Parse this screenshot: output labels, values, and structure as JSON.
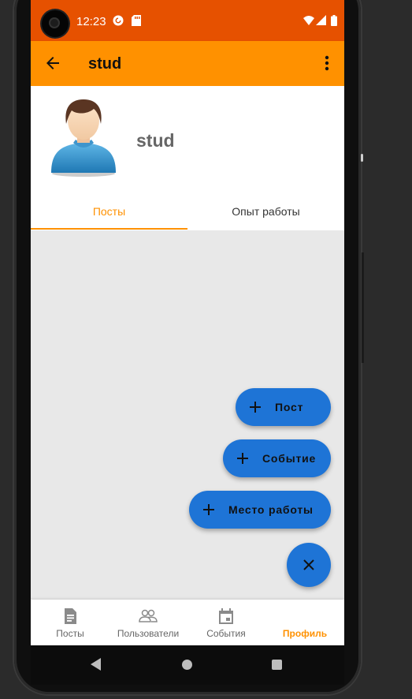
{
  "status_bar": {
    "time": "12:23",
    "left_icons": [
      "pocket-casts-icon",
      "sd-card-icon"
    ],
    "right_icons": [
      "wifi-icon",
      "signal-icon",
      "battery-icon"
    ]
  },
  "app_bar": {
    "title": "stud",
    "back_icon": "arrow-left-icon",
    "menu_icon": "more-vert-icon",
    "background": "#ff9100"
  },
  "profile": {
    "name": "stud",
    "avatar_icon": "user-avatar-icon"
  },
  "tabs": [
    {
      "label": "Посты",
      "selected": true
    },
    {
      "label": "Опыт работы",
      "selected": false
    }
  ],
  "fab_menu": {
    "items": [
      {
        "label": "Пост",
        "icon": "plus-icon"
      },
      {
        "label": "Событие",
        "icon": "plus-icon"
      },
      {
        "label": "Место работы",
        "icon": "plus-icon"
      }
    ],
    "close_icon": "close-icon",
    "color": "#1e74d6"
  },
  "bottom_nav": [
    {
      "label": "Посты",
      "icon": "document-icon",
      "active": false
    },
    {
      "label": "Пользователи",
      "icon": "people-icon",
      "active": false
    },
    {
      "label": "События",
      "icon": "calendar-icon",
      "active": false
    },
    {
      "label": "Профиль",
      "icon": "",
      "active": true
    }
  ],
  "colors": {
    "status_bar": "#e65100",
    "accent": "#ff9100",
    "fab": "#1e74d6",
    "content_bg": "#e8e8e8"
  }
}
